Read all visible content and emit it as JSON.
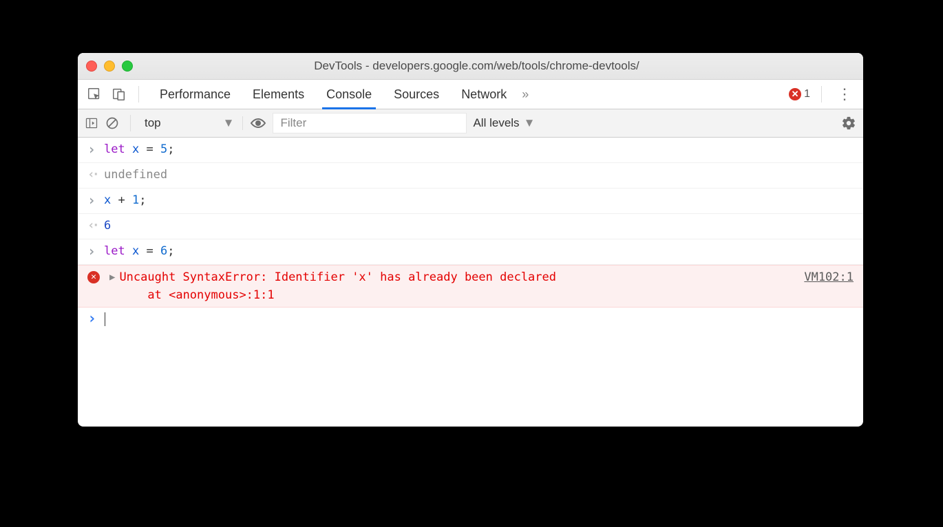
{
  "window": {
    "title": "DevTools - developers.google.com/web/tools/chrome-devtools/"
  },
  "tabs": {
    "items": [
      "Performance",
      "Elements",
      "Console",
      "Sources",
      "Network"
    ],
    "active": "Console",
    "overflow": "»",
    "error_count": "1"
  },
  "filterbar": {
    "context": "top",
    "filter_placeholder": "Filter",
    "levels_label": "All levels"
  },
  "console": {
    "rows": [
      {
        "kind": "input",
        "segments": [
          [
            "kw",
            "let"
          ],
          [
            "op",
            " "
          ],
          [
            "var",
            "x"
          ],
          [
            "op",
            " "
          ],
          [
            "op",
            "="
          ],
          [
            "op",
            " "
          ],
          [
            "num",
            "5"
          ],
          [
            "op",
            ";"
          ]
        ]
      },
      {
        "kind": "output",
        "segments": [
          [
            "undef",
            "undefined"
          ]
        ]
      },
      {
        "kind": "input",
        "segments": [
          [
            "var",
            "x"
          ],
          [
            "op",
            " "
          ],
          [
            "op",
            "+"
          ],
          [
            "op",
            " "
          ],
          [
            "num",
            "1"
          ],
          [
            "op",
            ";"
          ]
        ]
      },
      {
        "kind": "output",
        "segments": [
          [
            "output-num",
            "6"
          ]
        ]
      },
      {
        "kind": "input",
        "segments": [
          [
            "kw",
            "let"
          ],
          [
            "op",
            " "
          ],
          [
            "var",
            "x"
          ],
          [
            "op",
            " "
          ],
          [
            "op",
            "="
          ],
          [
            "op",
            " "
          ],
          [
            "num",
            "6"
          ],
          [
            "op",
            ";"
          ]
        ]
      },
      {
        "kind": "error",
        "text": "Uncaught SyntaxError: Identifier 'x' has already been declared\n    at <anonymous>:1:1",
        "source": "VM102:1"
      },
      {
        "kind": "prompt"
      }
    ]
  }
}
